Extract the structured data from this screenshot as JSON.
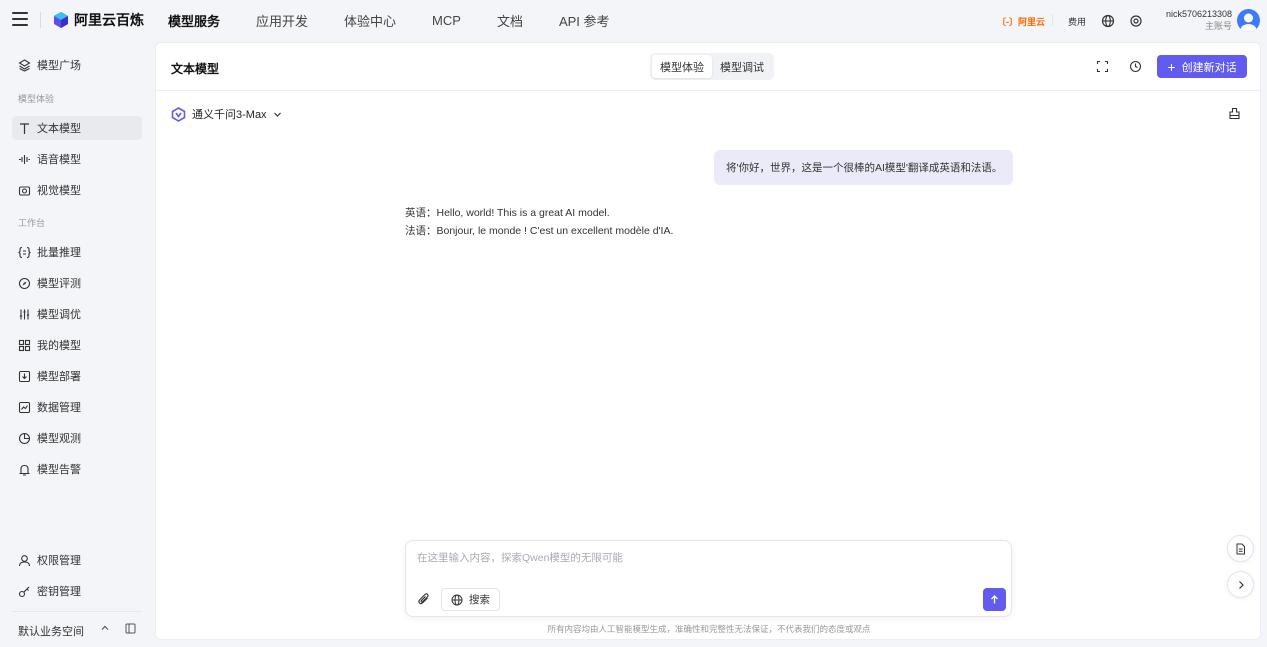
{
  "topbar": {
    "brand": "阿里云百炼",
    "nav": [
      "模型服务",
      "应用开发",
      "体验中心",
      "MCP",
      "文档",
      "API 参考"
    ],
    "aliyun_label": "〔-〕阿里云",
    "fee_label": "费用",
    "user_name": "nick5706213308",
    "user_role": "主账号"
  },
  "sidebar": {
    "top_item": "模型广场",
    "section_experience": "模型体验",
    "experience_items": [
      "文本模型",
      "语音模型",
      "视觉模型"
    ],
    "section_workbench": "工作台",
    "workbench_items": [
      "批量推理",
      "模型评测",
      "模型调优",
      "我的模型",
      "模型部署",
      "数据管理",
      "模型观测",
      "模型告警"
    ],
    "bottom_items": [
      "权限管理",
      "密钥管理"
    ],
    "workspace": "默认业务空间"
  },
  "main": {
    "title": "文本模型",
    "tabs": [
      "模型体验",
      "模型调试"
    ],
    "new_chat": "创建新对话",
    "model_name": "通义千问3-Max",
    "user_message": "将'你好，世界，这是一个很棒的AI模型'翻译成英语和法语。",
    "reply_lines": [
      "英语：Hello, world! This is a great AI model.",
      "法语：Bonjour, le monde ! C'est un excellent modèle d'IA."
    ],
    "input_placeholder": "在这里输入内容，探索Qwen模型的无限可能",
    "search_label": "搜索",
    "disclaimer": "所有内容均由人工智能模型生成，准确性和完整性无法保证，不代表我们的态度或观点"
  },
  "colors": {
    "accent": "#615ced",
    "aliyun_orange": "#ff6a00",
    "user_bubble": "#ebeaf9",
    "active_item_bg": "#e8eaef"
  }
}
